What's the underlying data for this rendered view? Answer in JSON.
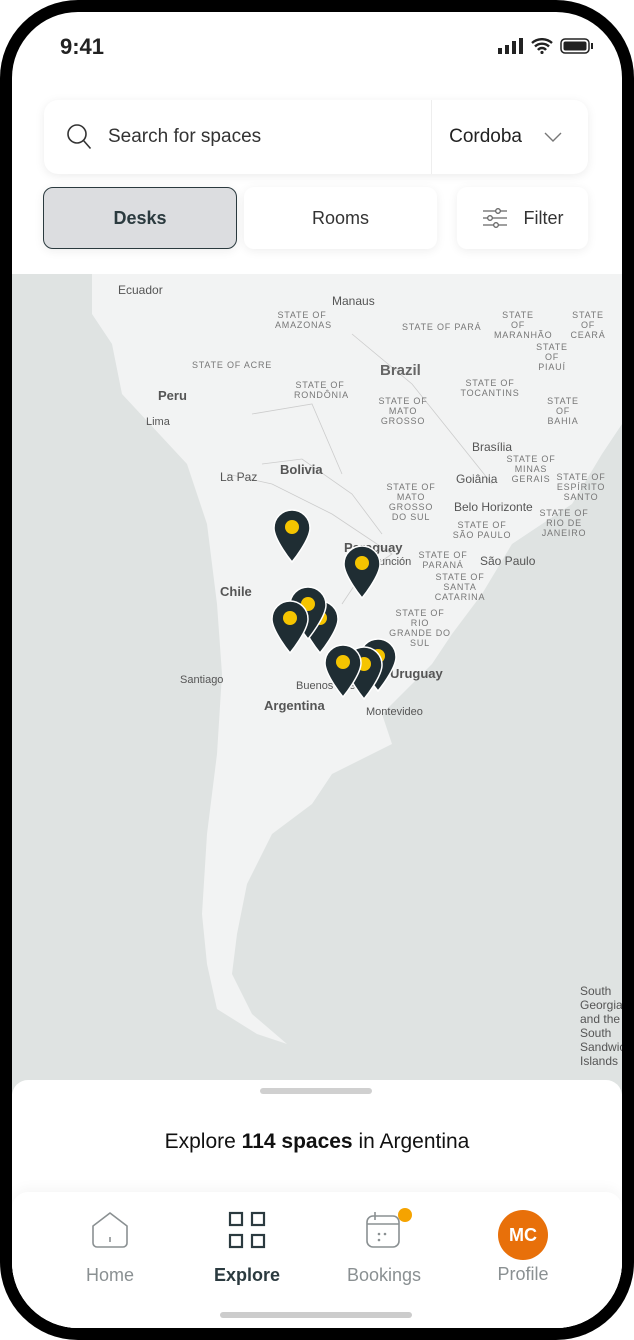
{
  "status": {
    "time": "9:41"
  },
  "search": {
    "placeholder": "Search for spaces",
    "city": "Cordoba"
  },
  "toggle": {
    "desks": "Desks",
    "rooms": "Rooms",
    "filter": "Filter",
    "selected": "Desks"
  },
  "map": {
    "labels": [
      "Ecuador",
      "Manaus",
      "STATE OF AMAZONAS",
      "STATE OF PARÁ",
      "STATE OF MARANHÃO",
      "STATE OF CEARÁ",
      "Brazil",
      "STATE OF PIAUÍ",
      "Peru",
      "Lima",
      "STATE OF ACRE",
      "STATE OF RONDÔNIA",
      "STATE OF MATO GROSSO",
      "STATE OF TOCANTINS",
      "STATE OF BAHIA",
      "La Paz",
      "Bolivia",
      "Brasília",
      "Goiânia",
      "STATE OF MINAS GERAIS",
      "STATE OF MATO GROSSO DO SUL",
      "Belo Horizonte",
      "STATE OF ESPÍRITO SANTO",
      "Paraguay",
      "Asunción",
      "STATE OF SÃO PAULO",
      "STATE OF RIO DE JANEIRO",
      "São Paulo",
      "STATE OF PARANÁ",
      "Chile",
      "STATE OF SANTA CATARINA",
      "STATE OF RIO GRANDE DO SUL",
      "Santiago",
      "Buenos Aires",
      "Uruguay",
      "Argentina",
      "Montevideo",
      "South Georgia and the South Sandwich Islands"
    ],
    "pin_color": "#1f2d33",
    "pin_dot": "#f5c400"
  },
  "sheet": {
    "prefix": "Explore ",
    "count": "114 spaces",
    "suffix": " in Argentina"
  },
  "nav": {
    "items": [
      {
        "label": "Home"
      },
      {
        "label": "Explore",
        "active": true
      },
      {
        "label": "Bookings",
        "badge": true
      },
      {
        "label": "Profile",
        "initials": "MC"
      }
    ]
  },
  "colors": {
    "accent": "#e8700a",
    "badge": "#f5a300",
    "dark": "#2b3a3f"
  }
}
